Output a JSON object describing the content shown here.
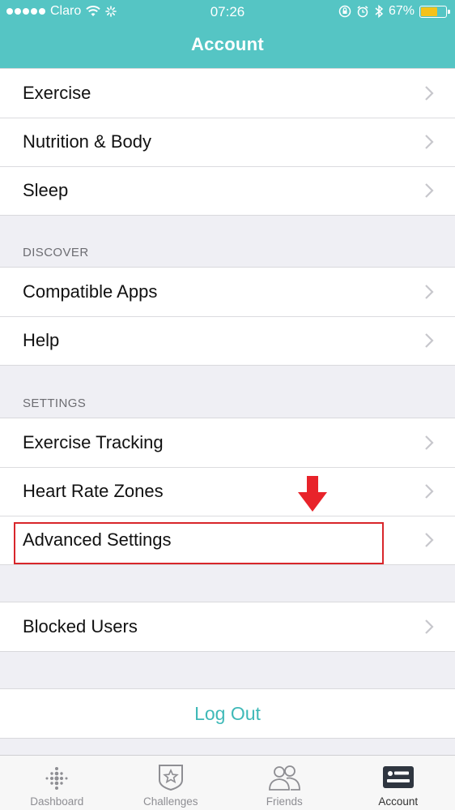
{
  "status_bar": {
    "carrier": "Claro",
    "time": "07:26",
    "battery_percent": "67%",
    "battery_level": 0.67,
    "battery_color": "#f4c21a"
  },
  "header": {
    "title": "Account",
    "background_color": "#55c5c4"
  },
  "groups": {
    "goals": {
      "items": [
        {
          "label": "Exercise"
        },
        {
          "label": "Nutrition & Body"
        },
        {
          "label": "Sleep"
        }
      ]
    },
    "discover": {
      "section_label": "DISCOVER",
      "items": [
        {
          "label": "Compatible Apps"
        },
        {
          "label": "Help"
        }
      ]
    },
    "settings": {
      "section_label": "SETTINGS",
      "items": [
        {
          "label": "Exercise Tracking"
        },
        {
          "label": "Heart Rate Zones"
        },
        {
          "label": "Advanced Settings"
        }
      ]
    },
    "privacy": {
      "items": [
        {
          "label": "Blocked Users"
        }
      ]
    },
    "session": {
      "logout_label": "Log Out",
      "logout_color": "#3fb9b8"
    }
  },
  "annotation": {
    "highlight_color": "#d8262b"
  },
  "tabbar": {
    "tabs": [
      {
        "label": "Dashboard",
        "icon": "dashboard-dots-icon"
      },
      {
        "label": "Challenges",
        "icon": "challenges-star-badge-icon"
      },
      {
        "label": "Friends",
        "icon": "friends-icon"
      },
      {
        "label": "Account",
        "icon": "account-card-icon",
        "active": true
      }
    ]
  }
}
